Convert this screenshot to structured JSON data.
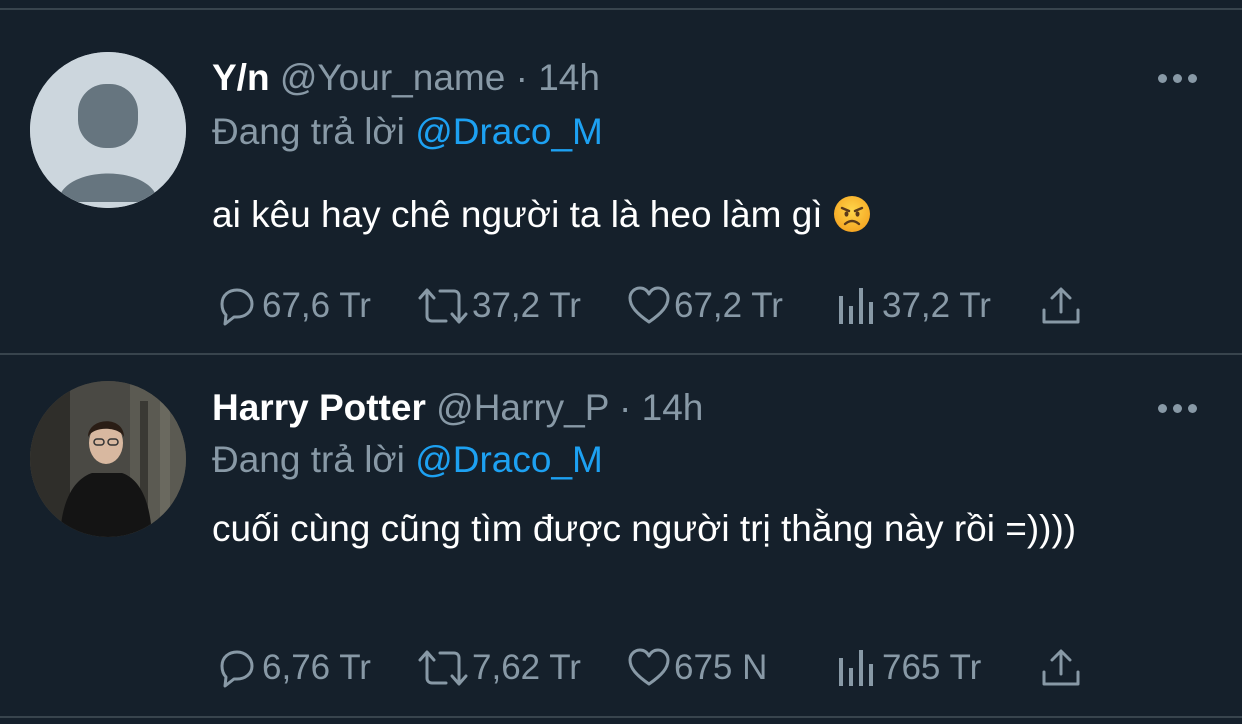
{
  "tweets": [
    {
      "name": "Y/n",
      "handle": "@Your_name",
      "separator": "·",
      "time": "14h",
      "replying_label": "Đang trả lời",
      "replying_to": "@Draco_M",
      "text": "ai kêu hay chê người ta là heo làm gì",
      "emoji": "angry-face-emoji",
      "avatar": "default-avatar",
      "replies": "67,6 Tr",
      "retweets": "37,2 Tr",
      "likes": "67,2 Tr",
      "views": "37,2 Tr"
    },
    {
      "name": "Harry Potter",
      "handle": "@Harry_P",
      "separator": "·",
      "time": "14h",
      "replying_label": "Đang trả lời",
      "replying_to": "@Draco_M",
      "text": "cuối cùng cũng tìm được người trị thằng này rồi =))))",
      "avatar": "harry-potter-photo",
      "replies": "6,76 Tr",
      "retweets": "7,62 Tr",
      "likes": "675 N",
      "views": "765 Tr"
    }
  ],
  "icons": {
    "reply": "reply-icon",
    "retweet": "retweet-icon",
    "like": "heart-icon",
    "views": "analytics-icon",
    "share": "share-icon",
    "more": "more-icon"
  },
  "colors": {
    "background": "#15202b",
    "divider": "#38444d",
    "secondary_text": "#8899a6",
    "mention": "#1da1f2"
  }
}
